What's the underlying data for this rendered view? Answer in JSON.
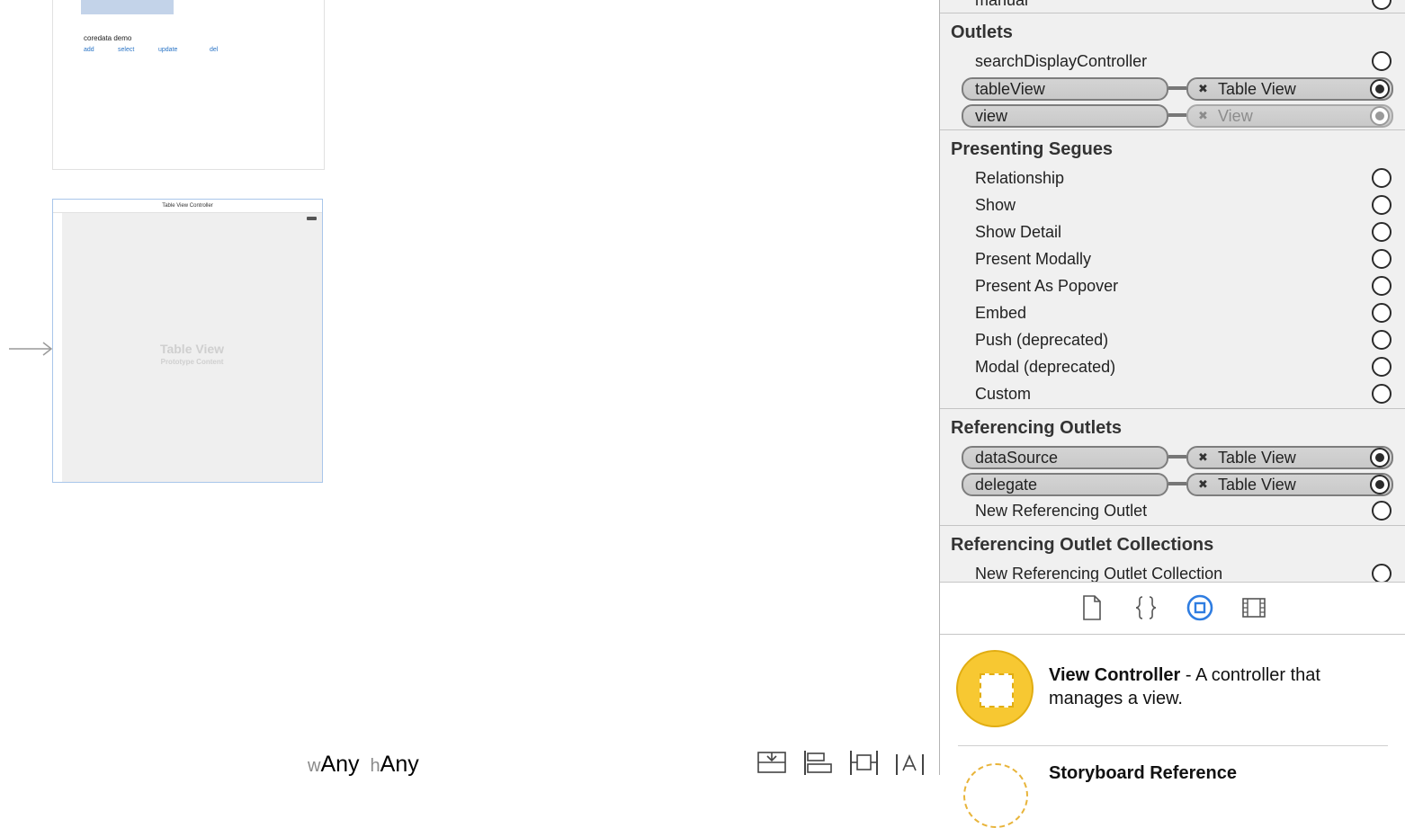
{
  "canvas": {
    "scene1": {
      "title": "coredata demo",
      "buttons": [
        "add",
        "select",
        "update",
        "del"
      ]
    },
    "scene2": {
      "header": "Table View Controller",
      "table_label": "Table View",
      "table_sublabel": "Prototype Content"
    },
    "size_class": {
      "w_key": "w",
      "w_value": "Any",
      "h_key": "h",
      "h_value": "Any"
    },
    "tools": [
      "stack-icon",
      "align-icon",
      "pin-icon",
      "resolve-icon"
    ]
  },
  "inspector": {
    "top_partial_row": "manual",
    "outlets": {
      "title": "Outlets",
      "rows": [
        {
          "label": "searchDisplayController",
          "connected": false
        },
        {
          "label": "tableView",
          "connected": true,
          "target": "Table View"
        },
        {
          "label": "view",
          "connected": true,
          "target": "View",
          "dim": true
        }
      ]
    },
    "presenting_segues": {
      "title": "Presenting Segues",
      "rows": [
        "Relationship",
        "Show",
        "Show Detail",
        "Present Modally",
        "Present As Popover",
        "Embed",
        "Push (deprecated)",
        "Modal (deprecated)",
        "Custom"
      ]
    },
    "referencing_outlets": {
      "title": "Referencing Outlets",
      "rows": [
        {
          "label": "dataSource",
          "target": "Table View"
        },
        {
          "label": "delegate",
          "target": "Table View"
        }
      ],
      "new_label": "New Referencing Outlet"
    },
    "referencing_outlet_collections": {
      "title": "Referencing Outlet Collections",
      "new_label": "New Referencing Outlet Collection"
    },
    "tabs": [
      {
        "name": "file-template-icon",
        "active": false
      },
      {
        "name": "code-snippet-icon",
        "active": false
      },
      {
        "name": "object-library-icon",
        "active": true
      },
      {
        "name": "media-library-icon",
        "active": false
      }
    ],
    "accent_color": "#2f7de1",
    "library": {
      "item_title": "View Controller",
      "item_desc": " - A controller that manages a view.",
      "next_item_partial": "Storyboard Reference"
    }
  }
}
